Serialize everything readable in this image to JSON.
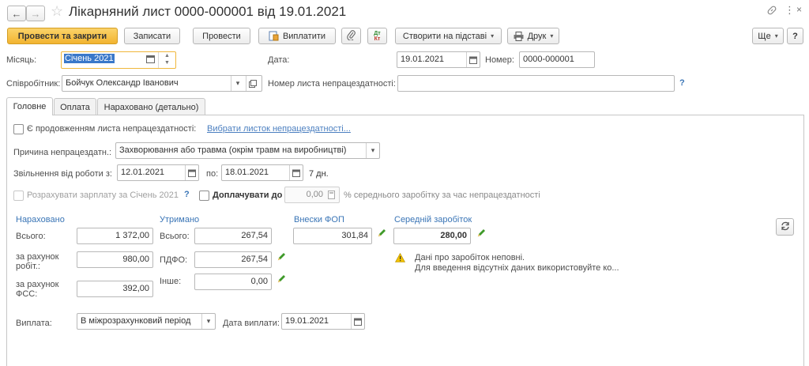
{
  "window": {
    "title": "Лікарняний лист 0000-000001 від 19.01.2021"
  },
  "toolbar": {
    "post_close": "Провести та закрити",
    "save": "Записати",
    "post": "Провести",
    "pay": "Виплатити",
    "create_based": "Створити на підставі",
    "print": "Друк",
    "more": "Ще",
    "help": "?"
  },
  "header": {
    "month_label": "Місяць:",
    "month_value": "Січень 2021",
    "date_label": "Дата:",
    "date_value": "19.01.2021",
    "number_label": "Номер:",
    "number_value": "0000-000001",
    "employee_label": "Співробітник:",
    "employee_value": "Бойчук Олександр Іванович",
    "sheet_number_label": "Номер листа непрацездатності:",
    "sheet_number_value": "",
    "sheet_help": "?"
  },
  "tabs": [
    {
      "label": "Головне",
      "active": true
    },
    {
      "label": "Оплата",
      "active": false
    },
    {
      "label": "Нараховано (детально)",
      "active": false
    }
  ],
  "main": {
    "continuation_label": "Є продовженням листа непрацездатності:",
    "choose_sheet_link": "Вибрати листок непрацездатності...",
    "reason_label": "Причина непрацездатн.:",
    "reason_value": "Захворювання або травма (окрім травм на виробництві)",
    "release_label": "Звільнення від роботи з:",
    "release_from": "12.01.2021",
    "release_to_label": "по:",
    "release_to": "18.01.2021",
    "days": "7 дн.",
    "calc_salary_label": "Розрахувати зарплату за Січень 2021",
    "calc_help": "?",
    "extra_pay_label": "Доплачувати до",
    "extra_pay_value": "0,00",
    "extra_pay_suffix": "% середнього заробітку за час непрацездатності"
  },
  "accrued": {
    "heading": "Нараховано",
    "total_label": "Всього:",
    "total_value": "1 372,00",
    "employer_label": "за рахунок робіт.:",
    "employer_value": "980,00",
    "fss_label": "за рахунок ФСС:",
    "fss_value": "392,00"
  },
  "withheld": {
    "heading": "Утримано",
    "total_label": "Всього:",
    "total_value": "267,54",
    "pdfo_label": "ПДФО:",
    "pdfo_value": "267,54",
    "other_label": "Інше:",
    "other_value": "0,00"
  },
  "fop": {
    "heading": "Внески ФОП",
    "value": "301,84"
  },
  "average": {
    "heading": "Середній заробіток",
    "value": "280,00",
    "warning_line1": "Дані про заробіток неповні.",
    "warning_line2": "Для введення відсутніх даних використовуйте ко..."
  },
  "payment": {
    "label": "Виплата:",
    "value": "В міжрозрахунковий період",
    "date_label": "Дата виплати:",
    "date_value": "19.01.2021"
  },
  "colors": {
    "accent": "#f2b430",
    "link": "#4b7fc0",
    "heading": "#3a75b6",
    "pencil": "#3f9a2a",
    "warning": "#e8b300"
  }
}
